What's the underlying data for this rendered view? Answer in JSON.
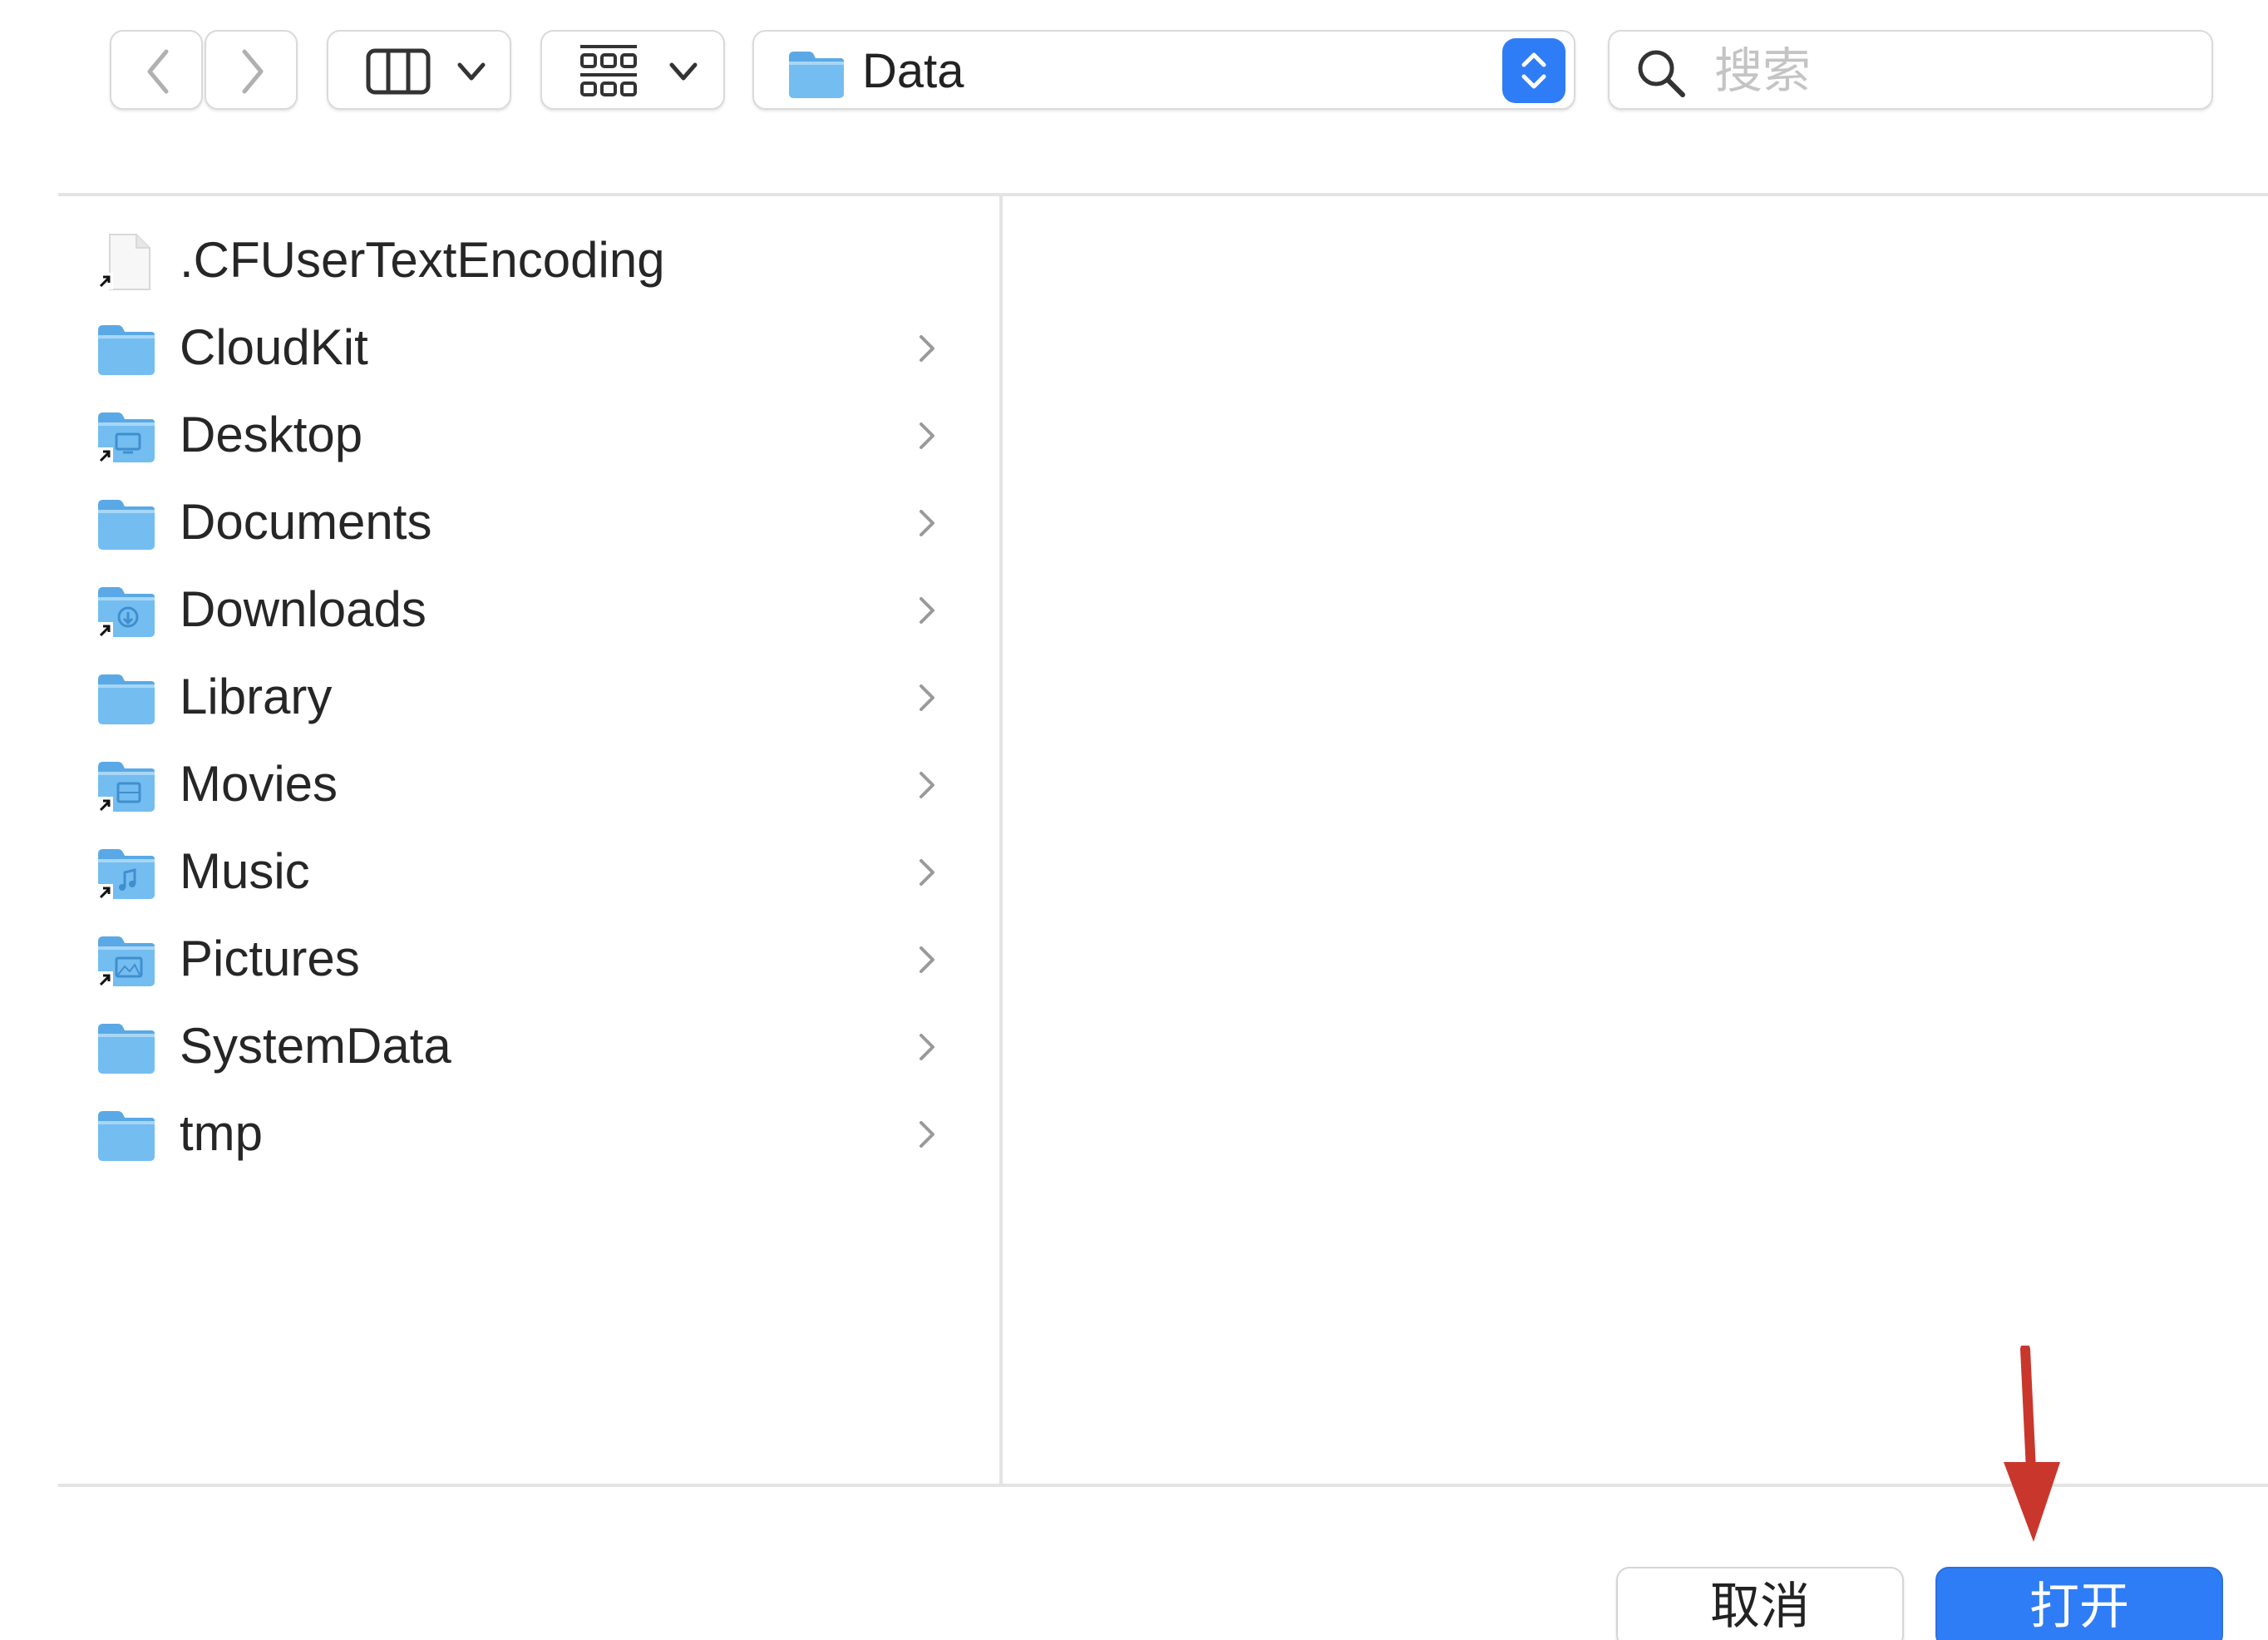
{
  "toolbar": {
    "back_icon": "chevron-left-icon",
    "forward_icon": "chevron-right-icon",
    "view_mode_icon": "column-view-icon",
    "group_icon": "icon-grid-icon",
    "path": {
      "label": "Data",
      "icon": "folder-icon"
    },
    "search": {
      "placeholder": "搜索",
      "value": ""
    }
  },
  "files": [
    {
      "name": ".CFUserTextEncoding",
      "kind": "file-alias",
      "has_children": false
    },
    {
      "name": "CloudKit",
      "kind": "folder",
      "has_children": true
    },
    {
      "name": "Desktop",
      "kind": "folder-alias-desktop",
      "has_children": true
    },
    {
      "name": "Documents",
      "kind": "folder",
      "has_children": true
    },
    {
      "name": "Downloads",
      "kind": "folder-alias-downloads",
      "has_children": true
    },
    {
      "name": "Library",
      "kind": "folder",
      "has_children": true
    },
    {
      "name": "Movies",
      "kind": "folder-alias-movies",
      "has_children": true
    },
    {
      "name": "Music",
      "kind": "folder-alias-music",
      "has_children": true
    },
    {
      "name": "Pictures",
      "kind": "folder-alias-pictures",
      "has_children": true
    },
    {
      "name": "SystemData",
      "kind": "folder",
      "has_children": true
    },
    {
      "name": "tmp",
      "kind": "folder",
      "has_children": true
    }
  ],
  "buttons": {
    "cancel": "取消",
    "open": "打开"
  },
  "colors": {
    "accent": "#2f7df6",
    "folder_blue": "#6db8ee",
    "annotation_arrow": "#c9372c"
  }
}
